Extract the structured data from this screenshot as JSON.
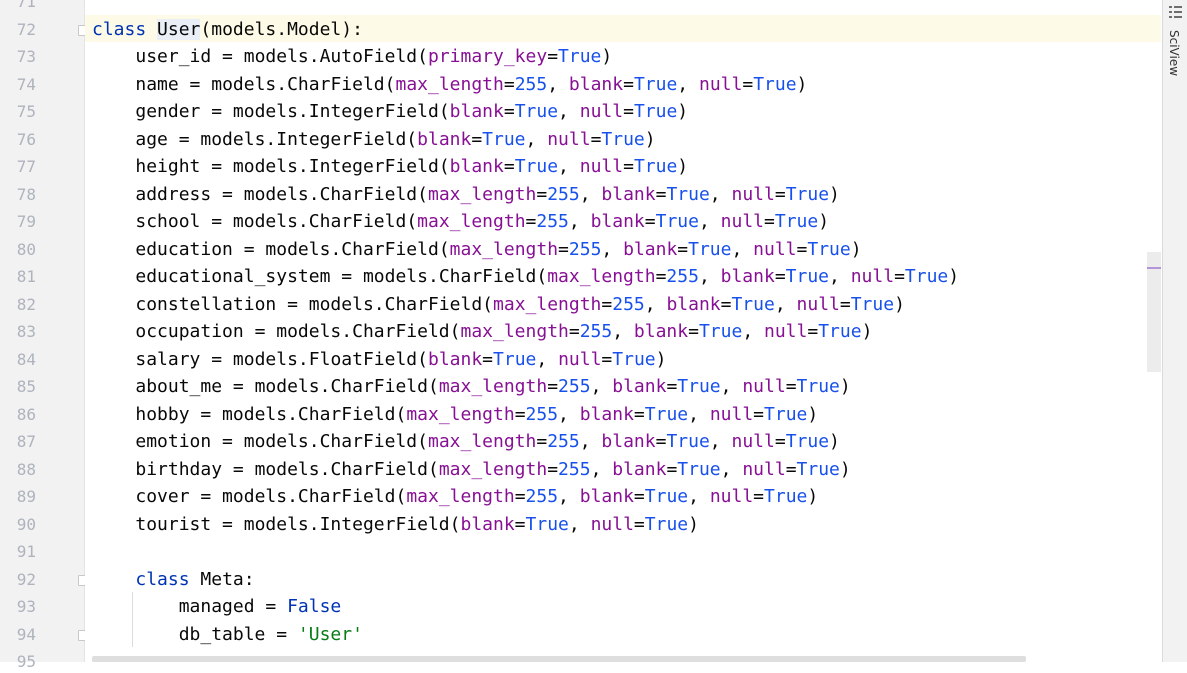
{
  "editor": {
    "line_numbers": [
      "71",
      "72",
      "73",
      "74",
      "75",
      "76",
      "77",
      "78",
      "79",
      "80",
      "81",
      "82",
      "83",
      "84",
      "85",
      "86",
      "87",
      "88",
      "89",
      "90",
      "91",
      "92",
      "93",
      "94",
      "95"
    ],
    "current_line": "72",
    "class_header": {
      "kw": "class",
      "name": "User",
      "rest": "(models.Model):"
    },
    "fields": [
      {
        "name": "user_id",
        "type": "AutoField",
        "args": [
          [
            "primary_key",
            "True"
          ]
        ]
      },
      {
        "name": "name",
        "type": "CharField",
        "args": [
          [
            "max_length",
            "255"
          ],
          [
            "blank",
            "True"
          ],
          [
            "null",
            "True"
          ]
        ]
      },
      {
        "name": "gender",
        "type": "IntegerField",
        "args": [
          [
            "blank",
            "True"
          ],
          [
            "null",
            "True"
          ]
        ]
      },
      {
        "name": "age",
        "type": "IntegerField",
        "args": [
          [
            "blank",
            "True"
          ],
          [
            "null",
            "True"
          ]
        ]
      },
      {
        "name": "height",
        "type": "IntegerField",
        "args": [
          [
            "blank",
            "True"
          ],
          [
            "null",
            "True"
          ]
        ]
      },
      {
        "name": "address",
        "type": "CharField",
        "args": [
          [
            "max_length",
            "255"
          ],
          [
            "blank",
            "True"
          ],
          [
            "null",
            "True"
          ]
        ]
      },
      {
        "name": "school",
        "type": "CharField",
        "args": [
          [
            "max_length",
            "255"
          ],
          [
            "blank",
            "True"
          ],
          [
            "null",
            "True"
          ]
        ]
      },
      {
        "name": "education",
        "type": "CharField",
        "args": [
          [
            "max_length",
            "255"
          ],
          [
            "blank",
            "True"
          ],
          [
            "null",
            "True"
          ]
        ]
      },
      {
        "name": "educational_system",
        "type": "CharField",
        "args": [
          [
            "max_length",
            "255"
          ],
          [
            "blank",
            "True"
          ],
          [
            "null",
            "True"
          ]
        ]
      },
      {
        "name": "constellation",
        "type": "CharField",
        "args": [
          [
            "max_length",
            "255"
          ],
          [
            "blank",
            "True"
          ],
          [
            "null",
            "True"
          ]
        ]
      },
      {
        "name": "occupation",
        "type": "CharField",
        "args": [
          [
            "max_length",
            "255"
          ],
          [
            "blank",
            "True"
          ],
          [
            "null",
            "True"
          ]
        ]
      },
      {
        "name": "salary",
        "type": "FloatField",
        "args": [
          [
            "blank",
            "True"
          ],
          [
            "null",
            "True"
          ]
        ]
      },
      {
        "name": "about_me",
        "type": "CharField",
        "args": [
          [
            "max_length",
            "255"
          ],
          [
            "blank",
            "True"
          ],
          [
            "null",
            "True"
          ]
        ]
      },
      {
        "name": "hobby",
        "type": "CharField",
        "args": [
          [
            "max_length",
            "255"
          ],
          [
            "blank",
            "True"
          ],
          [
            "null",
            "True"
          ]
        ]
      },
      {
        "name": "emotion",
        "type": "CharField",
        "args": [
          [
            "max_length",
            "255"
          ],
          [
            "blank",
            "True"
          ],
          [
            "null",
            "True"
          ]
        ]
      },
      {
        "name": "birthday",
        "type": "CharField",
        "args": [
          [
            "max_length",
            "255"
          ],
          [
            "blank",
            "True"
          ],
          [
            "null",
            "True"
          ]
        ]
      },
      {
        "name": "cover",
        "type": "CharField",
        "args": [
          [
            "max_length",
            "255"
          ],
          [
            "blank",
            "True"
          ],
          [
            "null",
            "True"
          ]
        ]
      },
      {
        "name": "tourist",
        "type": "IntegerField",
        "args": [
          [
            "blank",
            "True"
          ],
          [
            "null",
            "True"
          ]
        ]
      }
    ],
    "meta": {
      "kw": "class",
      "name": "Meta:",
      "managed_name": "managed",
      "managed_value": "False",
      "table_name": "db_table",
      "table_value": "'User'"
    }
  },
  "right_panel": {
    "label": "SciView",
    "icon": "sciview-grid-icon"
  },
  "colors": {
    "keyword": "#0033b3",
    "parameter": "#871094",
    "literal": "#1750eb",
    "string": "#067d17",
    "current_line_bg": "#fdfbe8"
  }
}
